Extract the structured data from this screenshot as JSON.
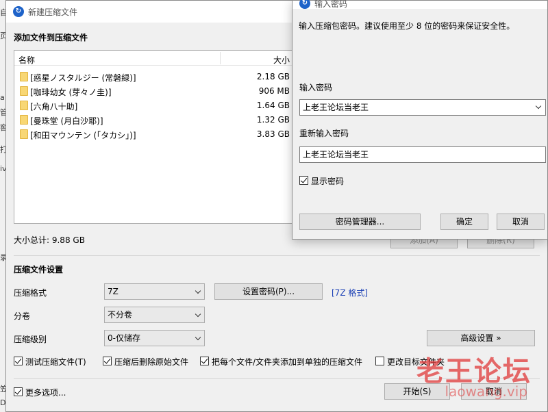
{
  "main_window": {
    "title": "新建压缩文件",
    "add_files_heading": "添加文件到压缩文件",
    "file_list": {
      "col_name": "名称",
      "col_size": "大小",
      "rows": [
        {
          "name": "[惑星ノスタルジー (常磐緑)]",
          "size": "2.18 GB"
        },
        {
          "name": "[咖琲幼女 (芽々ノ圭)]",
          "size": "906 MB"
        },
        {
          "name": "[六角八十助]",
          "size": "1.64 GB"
        },
        {
          "name": "[曼珠堂 (月白沙耶)]",
          "size": "1.32 GB"
        },
        {
          "name": "[和田マウンテン (「タカシ」)]",
          "size": "3.83 GB"
        }
      ]
    },
    "total_size": "大小总计: 9.88 GB",
    "add_button": "添加(A)",
    "remove_button": "删除(R)",
    "settings_heading": "压缩文件设置",
    "format_label": "压缩格式",
    "format_value": "7Z",
    "set_password_button": "设置密码(P)...",
    "format_link": "[7Z 格式]",
    "volume_label": "分卷",
    "volume_value": "不分卷",
    "level_label": "压缩级别",
    "level_value": "0-仅储存",
    "advanced_button": "高级设置 »",
    "checkboxes": [
      {
        "label": "测试压缩文件(T)",
        "checked": true
      },
      {
        "label": "压缩后删除原始文件",
        "checked": true
      },
      {
        "label": "把每个文件/文件夹添加到单独的压缩文件",
        "checked": true
      },
      {
        "label": "更改目标文件夹",
        "checked": false
      }
    ],
    "more_options": {
      "label": "更多选项...",
      "checked": true
    },
    "start_button": "开始(S)",
    "cancel_button": "取消"
  },
  "password_dialog": {
    "title": "输入密码",
    "description": "输入压缩包密码。建议使用至少 8 位的密码来保证安全性。",
    "password_label": "输入密码",
    "password_value": "上老王论坛当老王",
    "confirm_label": "重新输入密码",
    "confirm_value": "上老王论坛当老王",
    "show_password": {
      "label": "显示密码",
      "checked": true
    },
    "manager_button": "密码管理器...",
    "ok_button": "确定",
    "cancel_button": "取消"
  },
  "behind_window": {
    "fragments": [
      "自",
      "页",
      "a",
      "管",
      "窖",
      "打",
      "iv",
      "录",
      "笠",
      "D)"
    ]
  },
  "watermark": {
    "text": "老王论坛",
    "sub": "laowang.vip"
  },
  "colors": {
    "accent": "#1e63c9",
    "link": "#1a3fb5",
    "folder": "#f8d775",
    "watermark": "#e03a3a"
  }
}
